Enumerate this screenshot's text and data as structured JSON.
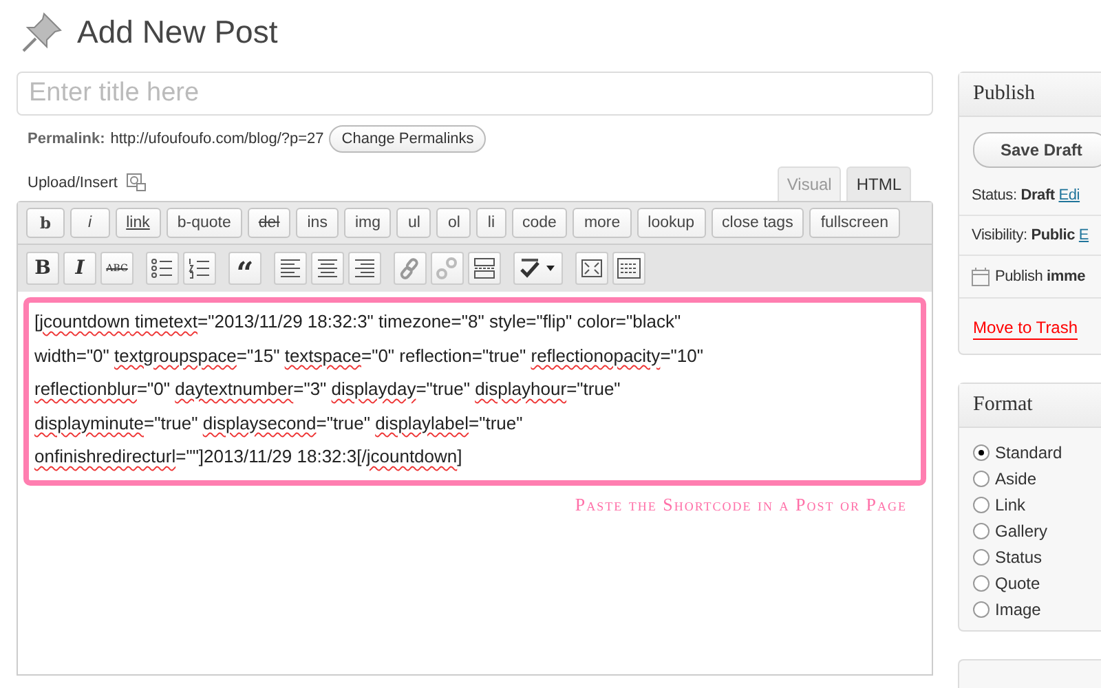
{
  "page_title": "Add New Post",
  "title_field": {
    "placeholder": "Enter title here"
  },
  "permalink": {
    "label": "Permalink:",
    "url": "http://ufoufoufo.com/blog/?p=27",
    "button": "Change Permalinks"
  },
  "upload_insert": "Upload/Insert",
  "editor_tabs": [
    {
      "label": "Visual",
      "selected": false
    },
    {
      "label": "HTML",
      "selected": true
    }
  ],
  "quicktags": [
    "b",
    "i",
    "link",
    "b-quote",
    "del",
    "ins",
    "img",
    "ul",
    "ol",
    "li",
    "code",
    "more",
    "lookup",
    "close tags",
    "fullscreen"
  ],
  "toolbar": [
    {
      "kind": "bold",
      "label": "B"
    },
    {
      "kind": "italic",
      "label": "I"
    },
    {
      "kind": "strike",
      "label": "ABC"
    },
    {
      "kind": "bullets"
    },
    {
      "kind": "numbers"
    },
    {
      "kind": "quote",
      "label": "“"
    },
    {
      "kind": "align-left"
    },
    {
      "kind": "align-center"
    },
    {
      "kind": "align-right"
    },
    {
      "kind": "link"
    },
    {
      "kind": "unlink"
    },
    {
      "kind": "more"
    },
    {
      "kind": "spell"
    },
    {
      "kind": "fullscreen"
    },
    {
      "kind": "kitchen"
    }
  ],
  "content_lines": [
    [
      {
        "text": "[jcountdown",
        "misspelled": true
      },
      {
        "text": " timetext",
        "misspelled": true
      },
      {
        "text": "=\"2013/11/29 18:32:3\" timezone=\"8\" style=\"flip\" color=\"black\"",
        "misspelled": false
      }
    ],
    [
      {
        "text": "width=\"0\" ",
        "misspelled": false
      },
      {
        "text": "textgroupspace",
        "misspelled": true
      },
      {
        "text": "=\"15\" ",
        "misspelled": false
      },
      {
        "text": "textspace",
        "misspelled": true
      },
      {
        "text": "=\"0\" reflection=\"true\" ",
        "misspelled": false
      },
      {
        "text": "reflectionopacity",
        "misspelled": true
      },
      {
        "text": "=\"10\"",
        "misspelled": false
      }
    ],
    [
      {
        "text": "reflectionblur",
        "misspelled": true
      },
      {
        "text": "=\"0\" ",
        "misspelled": false
      },
      {
        "text": "daytextnumber",
        "misspelled": true
      },
      {
        "text": "=\"3\" ",
        "misspelled": false
      },
      {
        "text": "displayday",
        "misspelled": true
      },
      {
        "text": "=\"true\" ",
        "misspelled": false
      },
      {
        "text": "displayhour",
        "misspelled": true
      },
      {
        "text": "=\"true\"",
        "misspelled": false
      }
    ],
    [
      {
        "text": "displayminute",
        "misspelled": true
      },
      {
        "text": "=\"true\" ",
        "misspelled": false
      },
      {
        "text": "displaysecond",
        "misspelled": true
      },
      {
        "text": "=\"true\" ",
        "misspelled": false
      },
      {
        "text": "displaylabel",
        "misspelled": true
      },
      {
        "text": "=\"true\"",
        "misspelled": false
      }
    ],
    [
      {
        "text": "onfinishredirecturl",
        "misspelled": true
      },
      {
        "text": "=\"\"]2013/11/29 18:32:3[/",
        "misspelled": false
      },
      {
        "text": "jcountdown",
        "misspelled": true
      },
      {
        "text": "]",
        "misspelled": false
      }
    ]
  ],
  "caption": "Paste the Shortcode in a Post or Page",
  "publish": {
    "title": "Publish",
    "save_draft": "Save Draft",
    "status_label": "Status:",
    "status_value": "Draft",
    "status_link": "Edi",
    "visibility_label": "Visibility:",
    "visibility_value": "Public",
    "visibility_link": "E",
    "schedule_label": "Publish",
    "schedule_value": "imme",
    "trash": "Move to Trash"
  },
  "format": {
    "title": "Format",
    "options": [
      {
        "label": "Standard",
        "selected": true
      },
      {
        "label": "Aside",
        "selected": false
      },
      {
        "label": "Link",
        "selected": false
      },
      {
        "label": "Gallery",
        "selected": false
      },
      {
        "label": "Status",
        "selected": false
      },
      {
        "label": "Quote",
        "selected": false
      },
      {
        "label": "Image",
        "selected": false
      }
    ]
  }
}
